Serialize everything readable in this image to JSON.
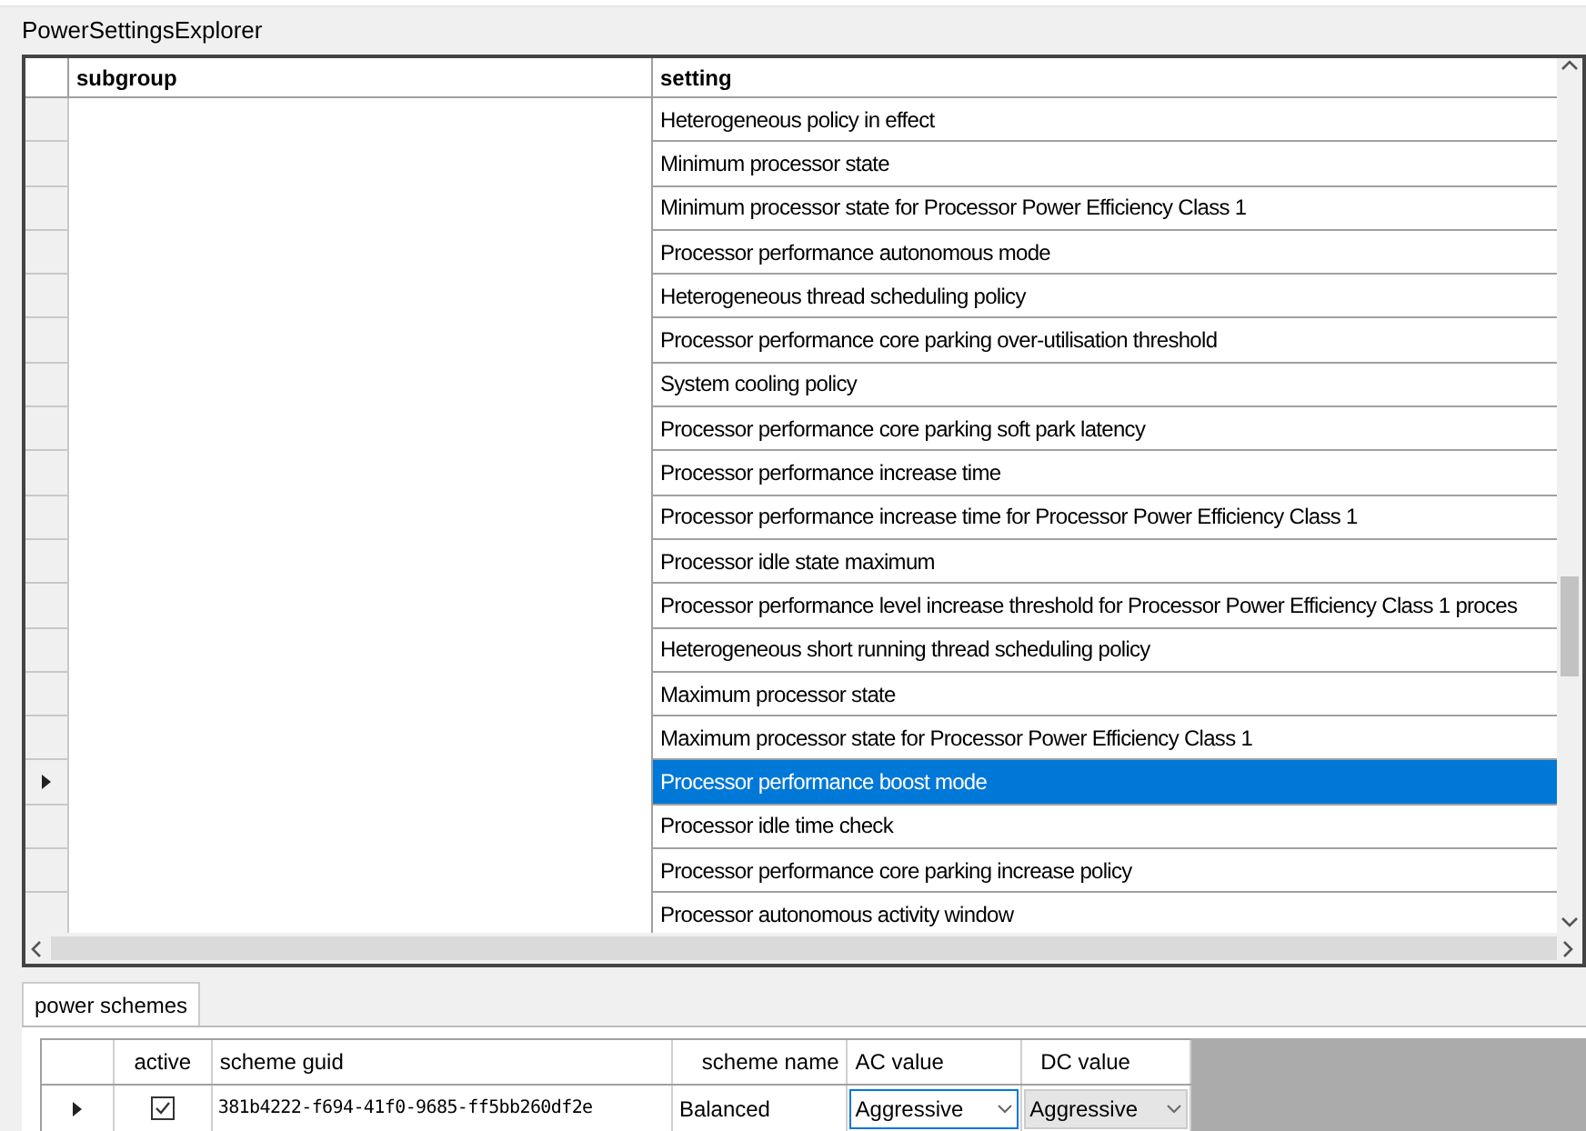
{
  "window": {
    "title": "PowerSettingsExplorer"
  },
  "settings_table": {
    "columns": [
      "subgroup",
      "setting"
    ],
    "rows": [
      {
        "setting": "Heterogeneous policy in effect",
        "selected": false
      },
      {
        "setting": "Minimum processor state",
        "selected": false
      },
      {
        "setting": "Minimum processor state for Processor Power Efficiency Class 1",
        "selected": false
      },
      {
        "setting": "Processor performance autonomous mode",
        "selected": false
      },
      {
        "setting": "Heterogeneous thread scheduling policy",
        "selected": false
      },
      {
        "setting": "Processor performance core parking over-utilisation threshold",
        "selected": false
      },
      {
        "setting": "System cooling policy",
        "selected": false
      },
      {
        "setting": "Processor performance core parking soft park latency",
        "selected": false
      },
      {
        "setting": "Processor performance increase time",
        "selected": false
      },
      {
        "setting": "Processor performance increase time for Processor Power Efficiency Class 1",
        "selected": false
      },
      {
        "setting": "Processor idle state maximum",
        "selected": false
      },
      {
        "setting": "Processor performance level increase threshold for Processor Power Efficiency Class 1 proces",
        "selected": false
      },
      {
        "setting": "Heterogeneous short running thread scheduling policy",
        "selected": false
      },
      {
        "setting": "Maximum processor state",
        "selected": false
      },
      {
        "setting": "Maximum processor state for Processor Power Efficiency Class 1",
        "selected": false
      },
      {
        "setting": "Processor performance boost mode",
        "selected": true
      },
      {
        "setting": "Processor idle time check",
        "selected": false
      },
      {
        "setting": "Processor performance core parking increase policy",
        "selected": false
      },
      {
        "setting": "Processor autonomous activity window",
        "selected": false
      }
    ]
  },
  "tabs": [
    {
      "label": "power schemes",
      "selected": true
    }
  ],
  "schemes_table": {
    "columns": [
      "active",
      "scheme guid",
      "scheme name",
      "AC value",
      "DC value"
    ],
    "rows": [
      {
        "active": true,
        "guid": "381b4222-f694-41f0-9685-ff5bb260df2e",
        "name": "Balanced",
        "ac_value": "Aggressive",
        "dc_value": "Aggressive",
        "selected": true
      }
    ]
  }
}
